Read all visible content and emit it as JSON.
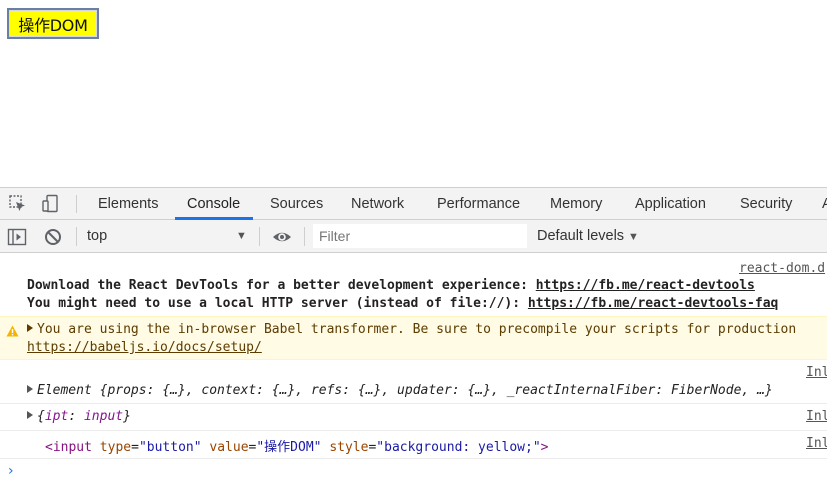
{
  "page": {
    "button_label": "操作DOM"
  },
  "devtools": {
    "tabs": [
      "Elements",
      "Console",
      "Sources",
      "Network",
      "Performance",
      "Memory",
      "Application",
      "Security",
      "A"
    ],
    "active_tab": "Console",
    "context": "top",
    "filter_placeholder": "Filter",
    "levels": "Default levels",
    "accent_color": "#1a73e8"
  },
  "console": {
    "messages": {
      "devtools_src": "react-dom.d",
      "devtools_line1": "Download the React DevTools for a better development experience: ",
      "devtools_link1": "https://fb.me/react-devtools",
      "devtools_line2": "You might need to use a local HTTP server (instead of file://): ",
      "devtools_link2": "https://fb.me/react-devtools-faq",
      "warn_text": "You are using the in-browser Babel transformer. Be sure to precompile your scripts for production",
      "warn_link": "https://babeljs.io/docs/setup/",
      "element_src": "Inl",
      "element_prefix": "Element ",
      "element_body": "{props: {…}, context: {…}, refs: {…}, updater: {…}, _reactInternalFiber: FiberNode, …}",
      "obj_src": "Inl",
      "obj_open": "{",
      "obj_key": "ipt",
      "obj_sep": ": ",
      "obj_val": "input",
      "obj_close": "}",
      "dom_src": "Inl",
      "dom_tag_open": "<input",
      "dom_attr_type": "type",
      "dom_val_type": "\"button\"",
      "dom_attr_value": "value",
      "dom_val_value": "\"操作DOM\"",
      "dom_attr_style": "style",
      "dom_val_style": "\"background: yellow;\"",
      "dom_tag_close": ">"
    },
    "prompt": "›"
  }
}
